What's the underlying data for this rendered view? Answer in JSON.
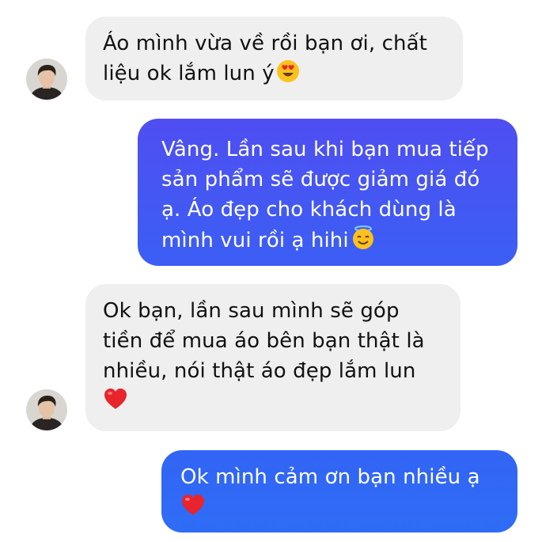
{
  "conversation": {
    "messages": [
      {
        "sender": "customer",
        "lines": [
          "Áo mình vừa về rồi bạn ơi, chất",
          "liệu ok lắm lun ý"
        ],
        "emoji": "heart-eyes-emoji"
      },
      {
        "sender": "shop",
        "lines": [
          "Vâng. Lần sau khi bạn mua tiếp",
          "sản phẩm sẽ được giảm giá đó",
          "ạ. Áo đẹp cho khách dùng là",
          "mình vui rồi ạ hihi"
        ],
        "emoji": "smiling-halo-emoji"
      },
      {
        "sender": "customer",
        "lines": [
          "Ok bạn, lần sau mình sẽ góp",
          "tiền để mua áo bên bạn thật là",
          "nhiều, nói thật áo đẹp lắm lun"
        ],
        "emoji": "red-heart-emoji"
      },
      {
        "sender": "shop",
        "lines": [
          "Ok mình cảm ơn bạn nhiều ạ"
        ],
        "emoji": "red-heart-emoji"
      }
    ]
  },
  "colors": {
    "incoming_bubble": "#efefef",
    "outgoing_top": "#4f4ef2",
    "outgoing_bottom": "#2f6df6",
    "heart": "#e8242c"
  }
}
